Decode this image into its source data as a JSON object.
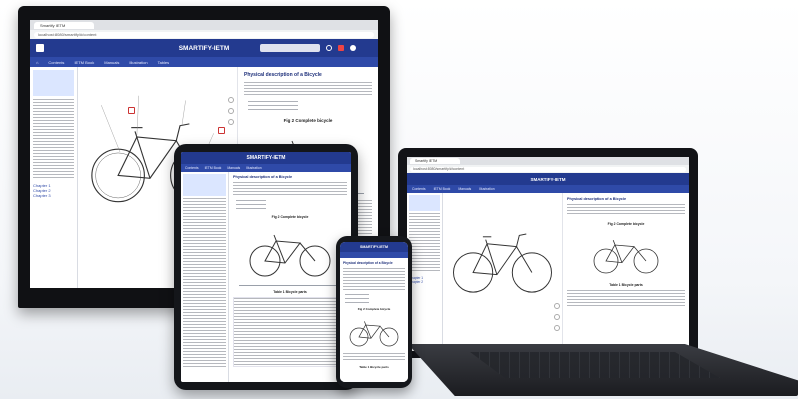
{
  "app": {
    "title": "SMARTIFY-IETM",
    "tab_title": "Smartify IETM",
    "url": "localhost:8080/smartify/#/content",
    "toolbar": {
      "home_label": "⌂",
      "content_label": "Contents",
      "items": [
        "IETM Book",
        "Manuals",
        "Illustration",
        "Tables"
      ]
    }
  },
  "document": {
    "heading": "Physical description of a Bicycle",
    "fig_caption": "Fig 2 Complete bicycle",
    "table_caption": "Table 1 Bicycle parts",
    "toc_chapters": [
      "Chapter 1",
      "Chapter 2",
      "Chapter 3"
    ]
  },
  "icons": {
    "menu": "hamburger-icon",
    "bike": "bicycle-drawing",
    "search": "search-icon"
  },
  "colors": {
    "header": "#233a8f",
    "toolbar": "#2f4aa8",
    "heading": "#1d2f7a"
  }
}
